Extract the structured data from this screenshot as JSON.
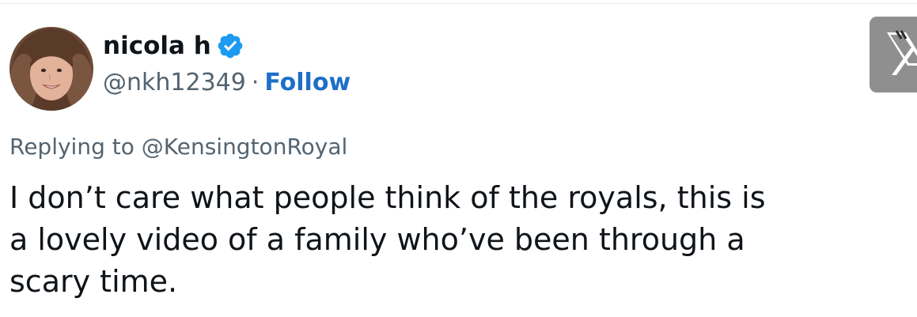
{
  "tweet": {
    "author": {
      "display_name": "nicola h",
      "handle": "@nkh12349",
      "separator": "·",
      "follow_label": "Follow",
      "verified": true,
      "avatar_icon": "profile-photo-icon"
    },
    "replying_to": "Replying to @KensingtonRoyal",
    "text": "I don’t care what people think of the royals, this is\na lovely video of a family who’ve been through a\nscary time.",
    "platform_icon": "x-logo-icon"
  },
  "colors": {
    "text_primary": "#0f1419",
    "text_secondary": "#536471",
    "link": "#1d6fc9",
    "verified_badge": "#1d9bf0",
    "logo_bg": "#8f8f8f"
  }
}
